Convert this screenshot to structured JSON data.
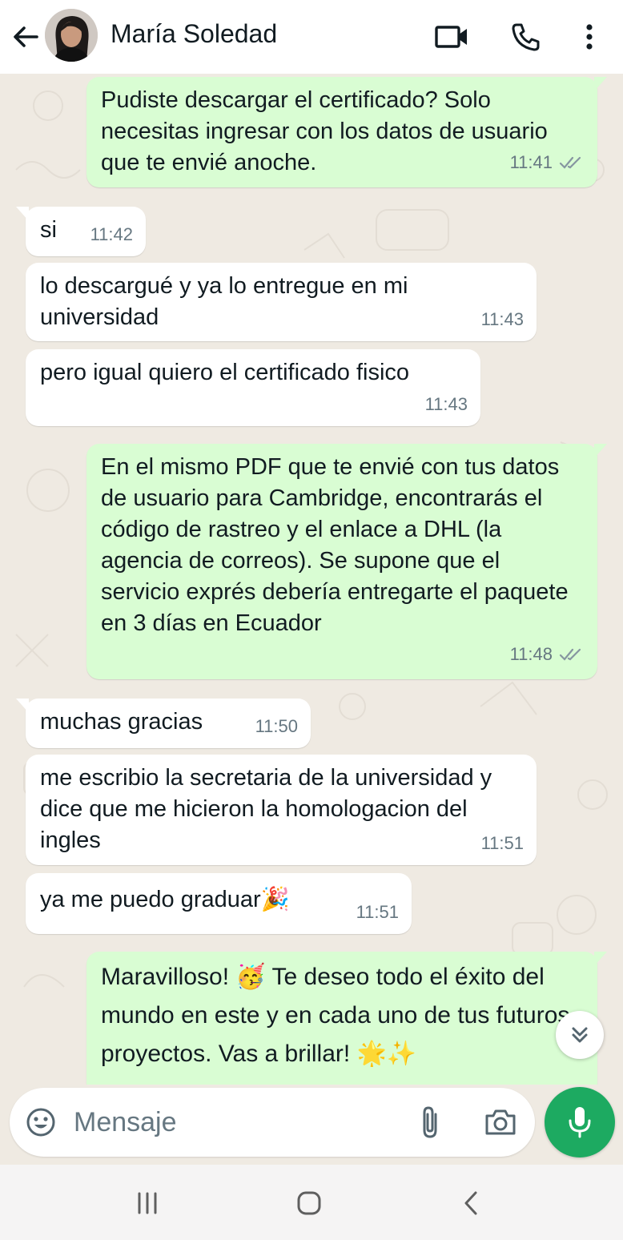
{
  "header": {
    "contact_name": "María Soledad",
    "icons": [
      "back-arrow-icon",
      "video-call-icon",
      "phone-icon",
      "more-options-icon"
    ]
  },
  "messages": [
    {
      "direction": "outgoing",
      "text": "Pudiste descargar el certificado? Solo necesitas ingresar con los datos de usuario que te envié anoche.",
      "time": "11:41",
      "status": "delivered"
    },
    {
      "direction": "incoming",
      "text": "si",
      "time": "11:42"
    },
    {
      "direction": "incoming",
      "text": "lo descargué y ya lo entregue en mi universidad",
      "time": "11:43"
    },
    {
      "direction": "incoming",
      "text": "pero igual quiero el certificado fisico",
      "time": "11:43"
    },
    {
      "direction": "outgoing",
      "text": "En el mismo PDF que te envié con tus datos de usuario para Cambridge, encontrarás el código de rastreo y el enlace a DHL (la agencia de correos). Se supone que el servicio exprés debería entregarte el paquete en 3 días en Ecuador",
      "time": "11:48",
      "status": "delivered"
    },
    {
      "direction": "incoming",
      "text": "muchas gracias",
      "time": "11:50"
    },
    {
      "direction": "incoming",
      "text": "me escribio la secretaria de la universidad y dice que me hicieron la homologacion del ingles",
      "time": "11:51"
    },
    {
      "direction": "incoming",
      "text": "ya me puedo graduar🎉",
      "time": "11:51"
    },
    {
      "direction": "outgoing",
      "text": "Maravilloso! 🥳 Te deseo todo el éxito del mundo en este y en cada uno de tus futuros proyectos. Vas a brillar! 🌟✨",
      "time": "",
      "status": ""
    }
  ],
  "composer": {
    "placeholder": "Mensaje",
    "icons": [
      "emoji-icon",
      "attach-icon",
      "camera-icon",
      "mic-icon"
    ]
  },
  "colors": {
    "outgoing_bubble": "#d9fdd3",
    "incoming_bubble": "#ffffff",
    "chat_background": "#efeae2",
    "accent_green": "#1daa61",
    "read_ticks": "#8696a0"
  },
  "navigation": {
    "buttons": [
      "recent-apps-icon",
      "home-icon",
      "back-nav-icon"
    ]
  }
}
